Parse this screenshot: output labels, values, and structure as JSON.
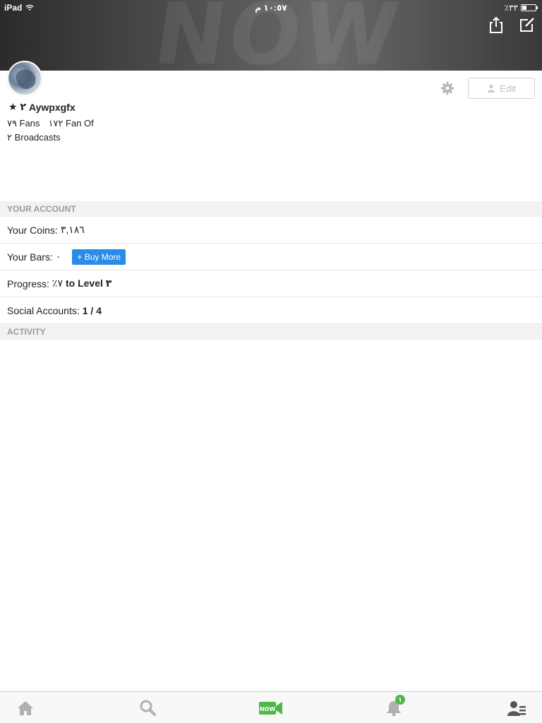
{
  "status_bar": {
    "device": "iPad",
    "time": "١٠:٥٧ م",
    "battery": "٪٣٣"
  },
  "header": {
    "watermark": "NOW",
    "share_icon": "share-icon",
    "compose_icon": "compose-icon"
  },
  "profile": {
    "level": "★ ٢",
    "username": "Aywpxgfx",
    "fans": "٧٩ Fans",
    "fan_of": "١٧٢ Fan Of",
    "broadcasts": "٢ Broadcasts",
    "edit_label": "Edit"
  },
  "account": {
    "header": "YOUR ACCOUNT",
    "coins_label": "Your Coins:",
    "coins_value": "٣,١٨٦",
    "bars_label": "Your Bars:",
    "bars_value": "٠",
    "buy_more": "+ Buy More",
    "progress_label": "Progress:",
    "progress_value": "٪٧",
    "progress_suffix": "to Level ٣",
    "social_label": "Social Accounts:",
    "social_value": "1 / 4"
  },
  "activity": {
    "header": "ACTIVITY"
  },
  "tabs": {
    "notification_badge": "١",
    "items": [
      "home-icon",
      "search-icon",
      "now-camera-icon",
      "notifications-bell-icon",
      "profile-icon"
    ]
  },
  "colors": {
    "accent_blue": "#2a8be8",
    "now_green": "#4cb84a",
    "section_gray": "#f2f2f2"
  }
}
